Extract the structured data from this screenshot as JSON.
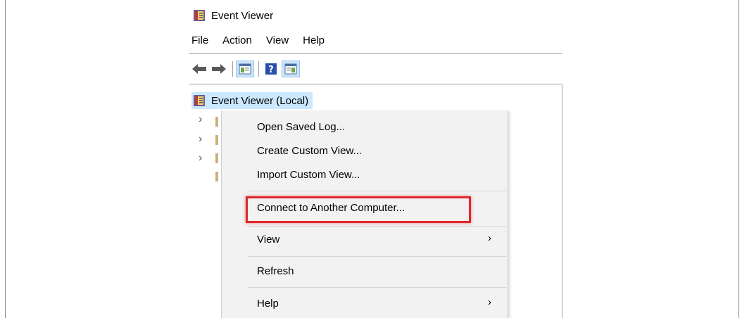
{
  "window": {
    "title": "Event Viewer"
  },
  "menubar": {
    "items": [
      "File",
      "Action",
      "View",
      "Help"
    ]
  },
  "toolbar": {
    "buttons": [
      "back-arrow-icon",
      "forward-arrow-icon",
      "show-hide-console-tree-icon",
      "help-icon",
      "show-hide-action-pane-icon"
    ]
  },
  "tree": {
    "root_label": "Event Viewer (Local)"
  },
  "context_menu": {
    "open_saved_log": "Open Saved Log...",
    "create_custom_view": "Create Custom View...",
    "import_custom_view": "Import Custom View...",
    "connect": "Connect to Another Computer...",
    "view": "View",
    "refresh": "Refresh",
    "help": "Help"
  },
  "colors": {
    "highlight_border": "#e0282e",
    "selection": "#cce8ff",
    "menu_bg": "#f2f2f2"
  }
}
